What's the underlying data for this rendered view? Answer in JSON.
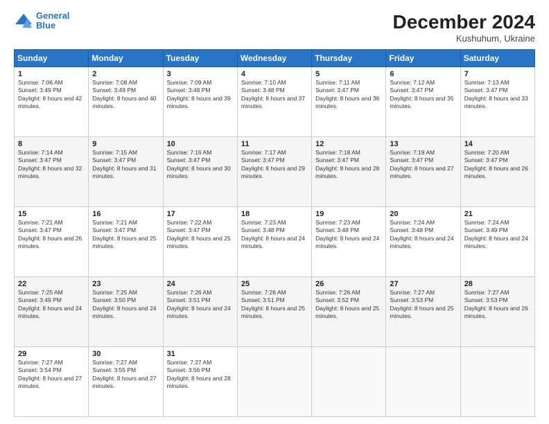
{
  "header": {
    "logo_line1": "General",
    "logo_line2": "Blue",
    "month": "December 2024",
    "location": "Kushuhum, Ukraine"
  },
  "days_of_week": [
    "Sunday",
    "Monday",
    "Tuesday",
    "Wednesday",
    "Thursday",
    "Friday",
    "Saturday"
  ],
  "weeks": [
    [
      {
        "day": "1",
        "sunrise": "7:06 AM",
        "sunset": "3:49 PM",
        "daylight": "8 hours and 42 minutes."
      },
      {
        "day": "2",
        "sunrise": "7:08 AM",
        "sunset": "3:49 PM",
        "daylight": "8 hours and 40 minutes."
      },
      {
        "day": "3",
        "sunrise": "7:09 AM",
        "sunset": "3:48 PM",
        "daylight": "8 hours and 39 minutes."
      },
      {
        "day": "4",
        "sunrise": "7:10 AM",
        "sunset": "3:48 PM",
        "daylight": "8 hours and 37 minutes."
      },
      {
        "day": "5",
        "sunrise": "7:11 AM",
        "sunset": "3:47 PM",
        "daylight": "8 hours and 36 minutes."
      },
      {
        "day": "6",
        "sunrise": "7:12 AM",
        "sunset": "3:47 PM",
        "daylight": "8 hours and 35 minutes."
      },
      {
        "day": "7",
        "sunrise": "7:13 AM",
        "sunset": "3:47 PM",
        "daylight": "8 hours and 33 minutes."
      }
    ],
    [
      {
        "day": "8",
        "sunrise": "7:14 AM",
        "sunset": "3:47 PM",
        "daylight": "8 hours and 32 minutes."
      },
      {
        "day": "9",
        "sunrise": "7:15 AM",
        "sunset": "3:47 PM",
        "daylight": "8 hours and 31 minutes."
      },
      {
        "day": "10",
        "sunrise": "7:16 AM",
        "sunset": "3:47 PM",
        "daylight": "8 hours and 30 minutes."
      },
      {
        "day": "11",
        "sunrise": "7:17 AM",
        "sunset": "3:47 PM",
        "daylight": "8 hours and 29 minutes."
      },
      {
        "day": "12",
        "sunrise": "7:18 AM",
        "sunset": "3:47 PM",
        "daylight": "8 hours and 28 minutes."
      },
      {
        "day": "13",
        "sunrise": "7:19 AM",
        "sunset": "3:47 PM",
        "daylight": "8 hours and 27 minutes."
      },
      {
        "day": "14",
        "sunrise": "7:20 AM",
        "sunset": "3:47 PM",
        "daylight": "8 hours and 26 minutes."
      }
    ],
    [
      {
        "day": "15",
        "sunrise": "7:21 AM",
        "sunset": "3:47 PM",
        "daylight": "8 hours and 26 minutes."
      },
      {
        "day": "16",
        "sunrise": "7:21 AM",
        "sunset": "3:47 PM",
        "daylight": "8 hours and 25 minutes."
      },
      {
        "day": "17",
        "sunrise": "7:22 AM",
        "sunset": "3:47 PM",
        "daylight": "8 hours and 25 minutes."
      },
      {
        "day": "18",
        "sunrise": "7:23 AM",
        "sunset": "3:48 PM",
        "daylight": "8 hours and 24 minutes."
      },
      {
        "day": "19",
        "sunrise": "7:23 AM",
        "sunset": "3:48 PM",
        "daylight": "8 hours and 24 minutes."
      },
      {
        "day": "20",
        "sunrise": "7:24 AM",
        "sunset": "3:48 PM",
        "daylight": "8 hours and 24 minutes."
      },
      {
        "day": "21",
        "sunrise": "7:24 AM",
        "sunset": "3:49 PM",
        "daylight": "8 hours and 24 minutes."
      }
    ],
    [
      {
        "day": "22",
        "sunrise": "7:25 AM",
        "sunset": "3:49 PM",
        "daylight": "8 hours and 24 minutes."
      },
      {
        "day": "23",
        "sunrise": "7:25 AM",
        "sunset": "3:50 PM",
        "daylight": "8 hours and 24 minutes."
      },
      {
        "day": "24",
        "sunrise": "7:26 AM",
        "sunset": "3:51 PM",
        "daylight": "8 hours and 24 minutes."
      },
      {
        "day": "25",
        "sunrise": "7:26 AM",
        "sunset": "3:51 PM",
        "daylight": "8 hours and 25 minutes."
      },
      {
        "day": "26",
        "sunrise": "7:26 AM",
        "sunset": "3:52 PM",
        "daylight": "8 hours and 25 minutes."
      },
      {
        "day": "27",
        "sunrise": "7:27 AM",
        "sunset": "3:53 PM",
        "daylight": "8 hours and 25 minutes."
      },
      {
        "day": "28",
        "sunrise": "7:27 AM",
        "sunset": "3:53 PM",
        "daylight": "8 hours and 26 minutes."
      }
    ],
    [
      {
        "day": "29",
        "sunrise": "7:27 AM",
        "sunset": "3:54 PM",
        "daylight": "8 hours and 27 minutes."
      },
      {
        "day": "30",
        "sunrise": "7:27 AM",
        "sunset": "3:55 PM",
        "daylight": "8 hours and 27 minutes."
      },
      {
        "day": "31",
        "sunrise": "7:27 AM",
        "sunset": "3:56 PM",
        "daylight": "8 hours and 28 minutes."
      },
      null,
      null,
      null,
      null
    ]
  ]
}
